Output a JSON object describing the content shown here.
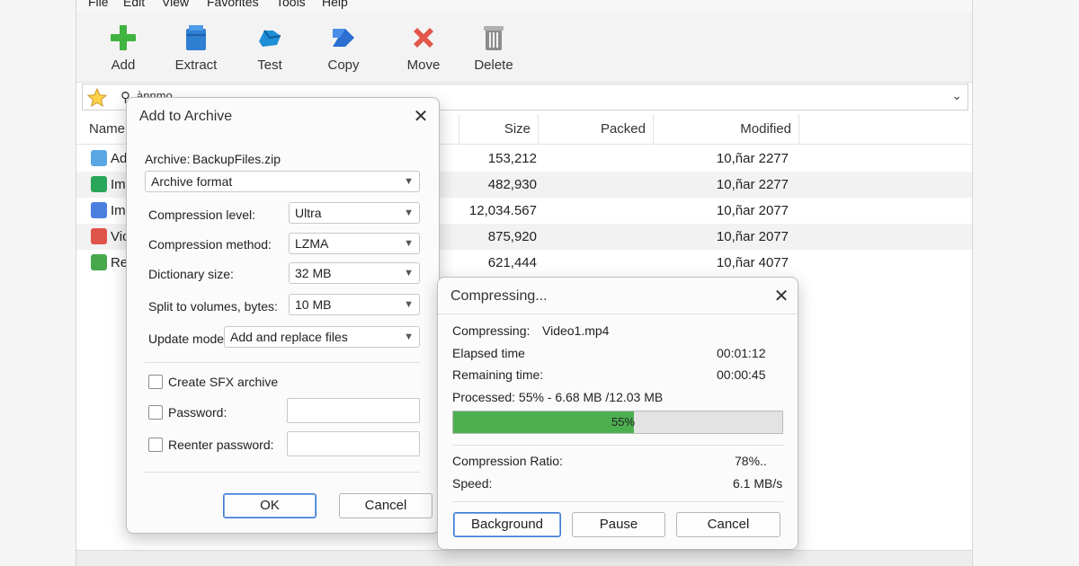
{
  "menu": [
    "File",
    "Edit",
    "View",
    "Favorites",
    "Tools",
    "Help"
  ],
  "toolbar": [
    {
      "label": "Add",
      "icon": "plus-icon"
    },
    {
      "label": "Extract",
      "icon": "extract-icon"
    },
    {
      "label": "Test",
      "icon": "test-icon"
    },
    {
      "label": "Copy",
      "icon": "copy-icon"
    },
    {
      "label": "Move",
      "icon": "move-icon"
    },
    {
      "label": "Delete",
      "icon": "delete-icon"
    }
  ],
  "address": {
    "path": "ànnmo",
    "star_icon": "favorite-star-icon",
    "search_icon": "search-icon"
  },
  "columns": [
    "Name",
    "Size",
    "Packed",
    "Modified"
  ],
  "files": [
    {
      "name": "Ad",
      "size": "153,212",
      "modified": "10,ñar 2277",
      "color": "#5aa7e6"
    },
    {
      "name": "Im",
      "size": "482,930",
      "modified": "10,ñar 2277",
      "color": "#2aa65a"
    },
    {
      "name": "Im",
      "size": "12,034.567",
      "modified": "10,ñar 2077",
      "color": "#4a7fe0"
    },
    {
      "name": "Vic",
      "size": "875,920",
      "modified": "10,ñar 2077",
      "color": "#e0554a"
    },
    {
      "name": "Re",
      "size": "621,444",
      "modified": "10,ñar 4077",
      "color": "#46a84a"
    }
  ],
  "add_dialog": {
    "title": "Add to Archive",
    "archive_label": "Archive:",
    "archive_name": "BackupFiles.zip",
    "format_value": "Archive format",
    "fields": [
      {
        "label": "Compression level:",
        "value": "Ultra"
      },
      {
        "label": "Compression method:",
        "value": "LZMA"
      },
      {
        "label": "Dictionary size:",
        "value": "32 MB"
      },
      {
        "label": "Split to volumes, bytes:",
        "value": "10 MB"
      }
    ],
    "update_label": "Update mode:",
    "update_value": "Add and replace files",
    "sfx_label": "Create SFX archive",
    "password_label": "Password:",
    "reenter_label": "Reenter password:",
    "ok_label": "OK",
    "cancel_label": "Cancel"
  },
  "progress_dialog": {
    "title": "Compressing...",
    "compressing_label": "Compressing:",
    "compressing_file": "Video1.mp4",
    "elapsed_label": "Elapsed time",
    "elapsed_value": "00:01:12",
    "remaining_label": "Remaining time:",
    "remaining_value": "00:00:45",
    "processed_text": "Processed: 55% - 6.68 MB /12.03 MB",
    "progress_percent": 55,
    "progress_label": "55%",
    "ratio_label": "Compression Ratio:",
    "ratio_value": "78%..",
    "speed_label": "Speed:",
    "speed_value": "6.1 MB/s",
    "background_label": "Background",
    "pause_label": "Pause",
    "cancel_label": "Cancel"
  }
}
